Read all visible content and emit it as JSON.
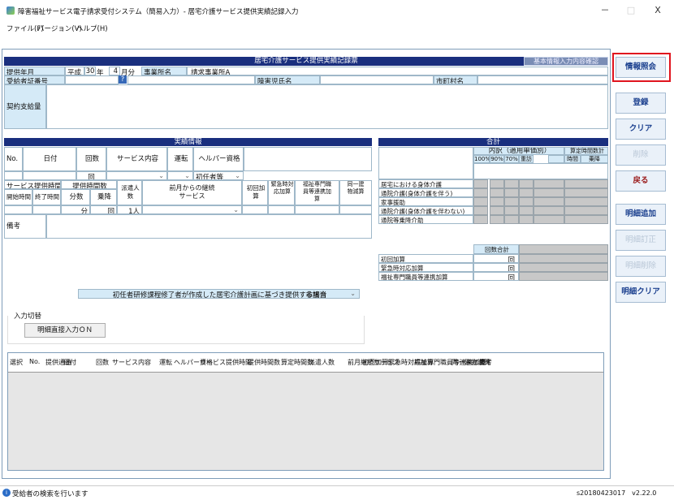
{
  "window": {
    "title": "障害福祉サービス電子請求受付システム（簡易入力）- 居宅介護サービス提供実績記録入力",
    "minimize": "－",
    "maximize": "□",
    "close": "X"
  },
  "menu": [
    "ファイル(F)",
    "バージョン(V)",
    "ヘルプ(H)"
  ],
  "record": {
    "header": "居宅介護サービス提供実績記録票",
    "basic_info_btn": "基本情報入力内容確認",
    "provision_month_label": "提供年月",
    "era": "平成",
    "year": "30",
    "year_unit": "年",
    "month": "4",
    "month_unit": "月分",
    "office_label": "事業所名",
    "office_value": "請求事業所A",
    "recipient_no_label": "受給者証番号",
    "help_btn": "?",
    "child_name_label": "障害児氏名",
    "municipality_label": "市町村名",
    "contract_label": "契約支給量"
  },
  "record_info": {
    "header": "実績情報",
    "no": "No.",
    "date": "日付",
    "count": "回数",
    "service": "サービス内容",
    "driving": "運転",
    "helper": "ヘルパー資格",
    "count_unit": "回",
    "helper_value": "初任者等",
    "provision_time": "サービス提供時間",
    "provision_hours": "提供時間数",
    "dispatch": "派遣人数",
    "continuing": "前月からの継続サービス",
    "initial": "初回加算",
    "emergency": "緊急時対応加算",
    "specialist": "福祉専門職員等連携加算",
    "same_building": "同一建物減算",
    "start": "開始時間",
    "end": "終了時間",
    "minutes": "分数",
    "boarding": "乗降",
    "min_unit": "分",
    "times_unit": "回",
    "people_value": "1",
    "people_unit": "人",
    "remarks": "備考",
    "plan_note": "初任者研修課程修了者が作成した居宅介護計画に基づき提供する場合",
    "plan_value": "非該当"
  },
  "totals": {
    "header": "合計",
    "breakdown": "内訳（適用単価別）",
    "calc_hours": "算定時間数計",
    "cols": [
      "100%",
      "90%",
      "70%",
      "重訪",
      "時間",
      "乗降"
    ],
    "rows": [
      "居宅における身体介護",
      "通院介護(身体介護を伴う)",
      "家事援助",
      "通院介護(身体介護を伴わない)",
      "通院等乗降介助"
    ],
    "count_total": "回数合計",
    "add_rows": [
      "初回加算",
      "緊急時対応加算",
      "福祉専門職員等連携加算"
    ],
    "unit": "回"
  },
  "input": {
    "group": "入力切替",
    "detail_btn": "明細直接入力ＯＮ"
  },
  "list": {
    "headers": [
      "選択",
      "No.",
      "提供通番",
      "日付",
      "回数",
      "サービス内容",
      "運転",
      "ヘルパー資格",
      "サービス提供時間",
      "提供時間数",
      "算定時間数",
      "派遣人数",
      "前月継続サービス",
      "初回加算",
      "緊急時対応加算",
      "福祉専門職員等連携加算",
      "同一建物減算",
      "備考"
    ],
    "sub": [
      "開始時間",
      "終了時間",
      "分数",
      "乗降",
      "時間",
      "乗降"
    ]
  },
  "side": {
    "info_lookup": "情報照会",
    "register": "登録",
    "clear": "クリア",
    "delete": "削除",
    "back": "戻る",
    "add_detail": "明細追加",
    "fix_detail": "明細訂正",
    "del_detail": "明細削除",
    "clear_detail": "明細クリア"
  },
  "status": {
    "message": "受給者の検索を行います",
    "version": "s20180423017　v2.22.0"
  },
  "colors": {
    "header_navy": "#1a2f7e",
    "label_blue": "#d5eaf7",
    "highlight_red": "#e0141e",
    "side_text": "#1a3f8e"
  }
}
